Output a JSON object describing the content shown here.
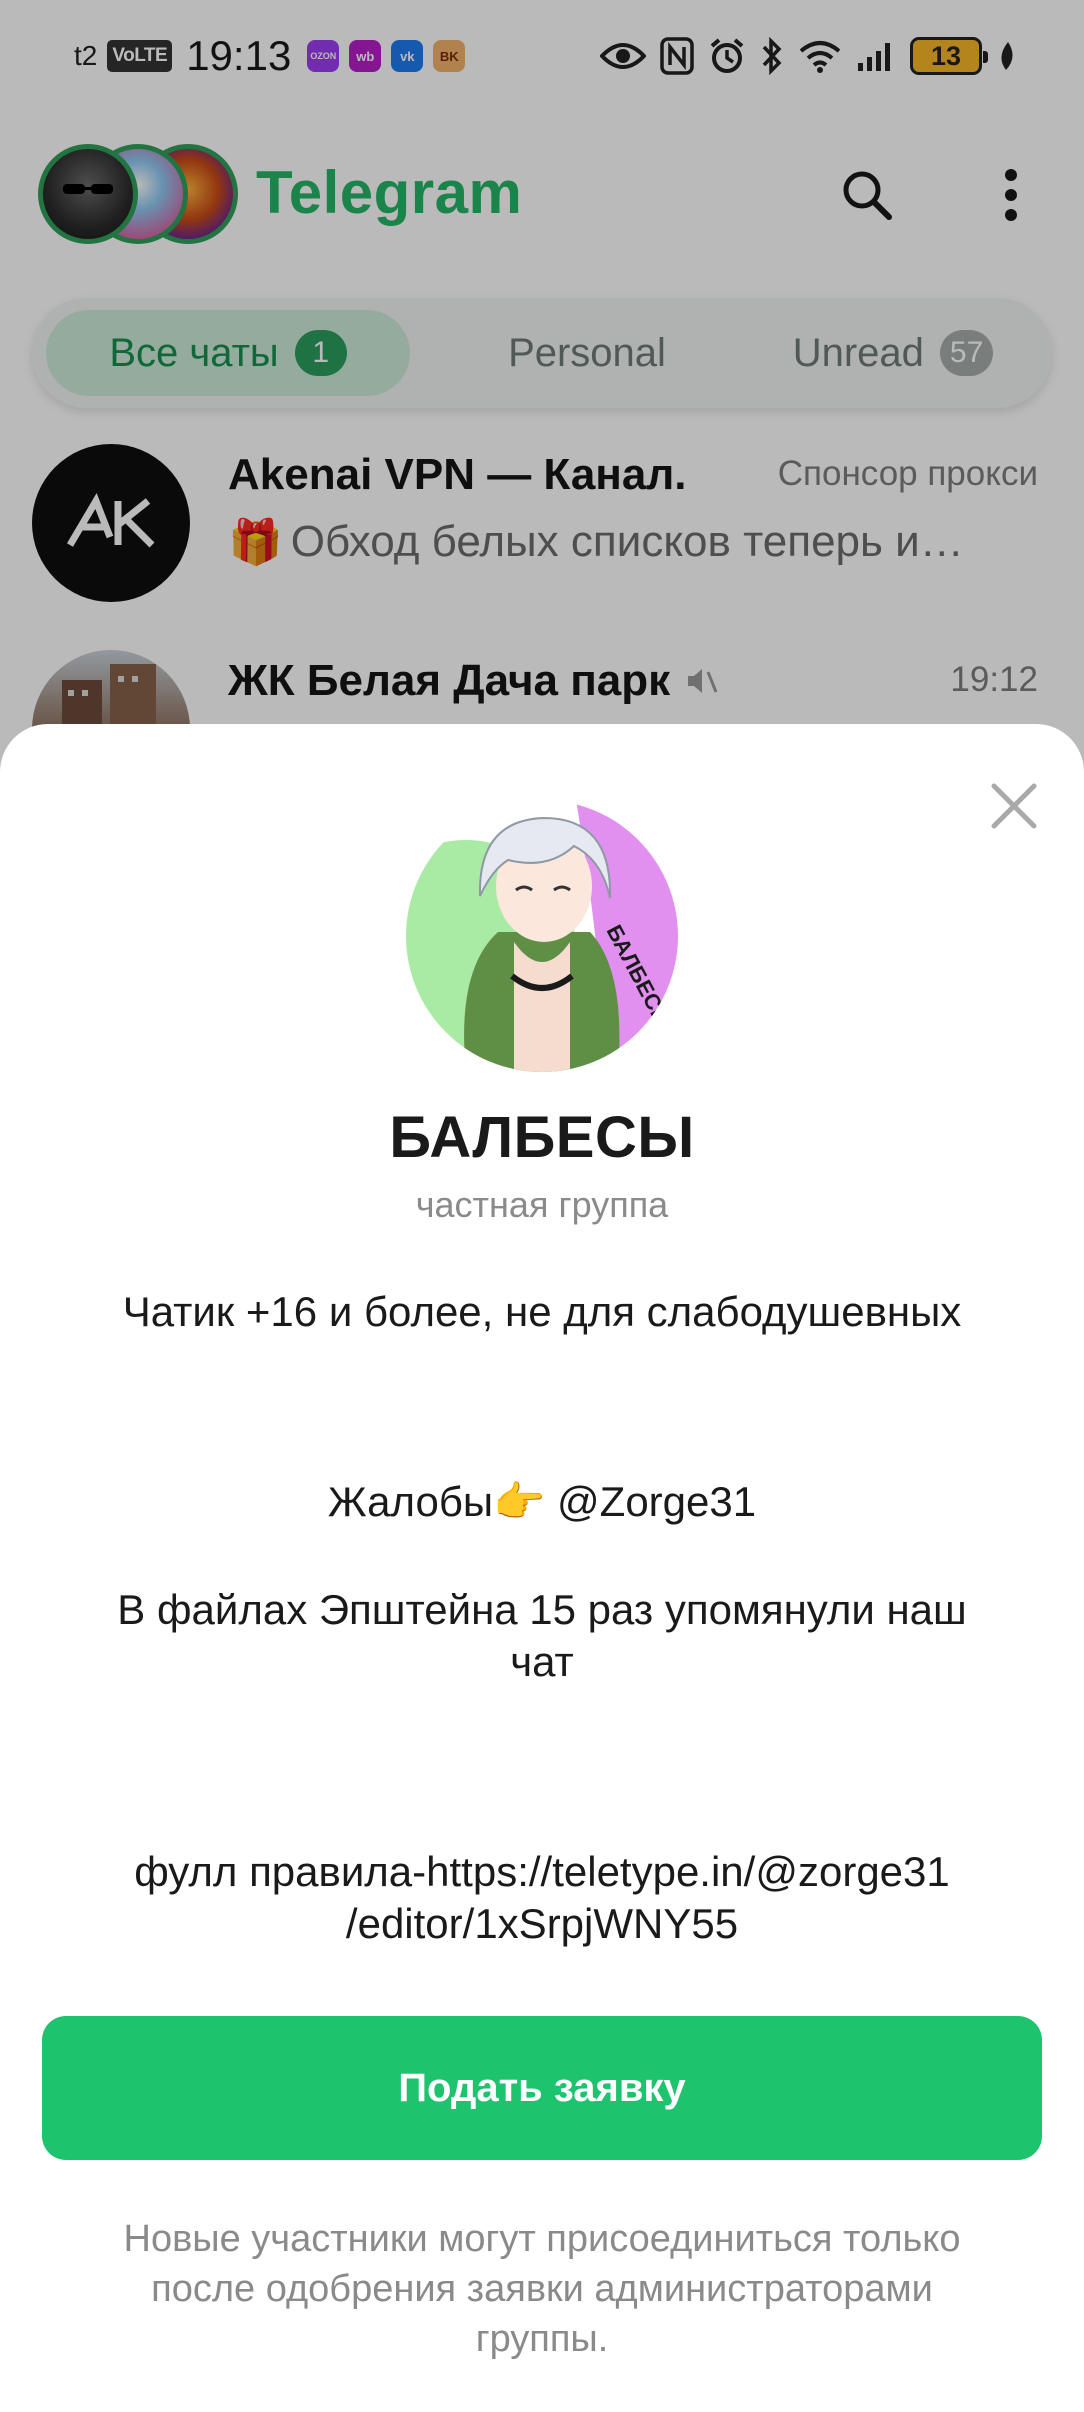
{
  "status_bar": {
    "carrier": "t2",
    "volte": "VoLTE",
    "time": "19:13",
    "app_icons": [
      {
        "name": "ozon-icon",
        "text": "OZON",
        "color": "#9c3df0"
      },
      {
        "name": "wildberries-icon",
        "text": "wb",
        "color": "#b51fc9"
      },
      {
        "name": "vk-icon",
        "text": "vk",
        "color": "#1f7cf0"
      },
      {
        "name": "burger-king-icon",
        "text": "BK",
        "color": "#f3b26a"
      }
    ],
    "battery": "13"
  },
  "header": {
    "title": "Telegram"
  },
  "tabs": [
    {
      "label": "Все чаты",
      "badge": "1",
      "active": true
    },
    {
      "label": "Personal",
      "badge": "",
      "active": false
    },
    {
      "label": "Unread",
      "badge": "57",
      "active": false
    }
  ],
  "chats": [
    {
      "name": "Akenai VPN — Канал.",
      "meta": "Спонсор прокси",
      "preview": "Обход белых списков теперь и…",
      "preview_emoji": "🎁"
    },
    {
      "name": "ЖК Белая Дача парк",
      "meta": "19:12",
      "preview": "",
      "muted": true
    }
  ],
  "sheet": {
    "group_name": "БАЛБЕСЫ",
    "group_type": "частная группа",
    "photo_text": "БАЛБЕСЫ",
    "description_lines": [
      "Чатик +16 и более, не для слабодушевных",
      "Жалобы👉 @Zorge31",
      "В файлах Эпштейна 15 раз упомянули наш чат",
      "фулл правила-https://teletype.in/@zorge31 /editor/1xSrpjWNY55"
    ],
    "join_button": "Подать заявку",
    "footnote": "Новые участники могут присоединиться только после одобрения заявки администраторами группы."
  },
  "colors": {
    "accent": "#26b566",
    "button": "#1ec36e",
    "tab_active_bg": "#cdebd9",
    "tab_badge": "#2a9d5e",
    "unread_badge": "#a7aca9"
  }
}
